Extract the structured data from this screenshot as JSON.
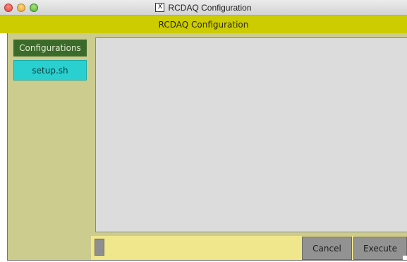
{
  "window": {
    "title": "RCDAQ Configuration",
    "title_icon": "x11-icon"
  },
  "header": {
    "title": "RCDAQ Configuration"
  },
  "sidebar": {
    "heading": "Configurations",
    "items": [
      {
        "label": "setup.sh"
      }
    ]
  },
  "main": {
    "text_content": ""
  },
  "buttons": {
    "cancel": "Cancel",
    "execute": "Execute"
  },
  "colors": {
    "header_bg": "#cdcc00",
    "sidebar_bg": "#cccc8f",
    "heading_bg": "#3b6b2b",
    "item_bg": "#2ad0cf",
    "bottom_bar_bg": "#f0e68c",
    "button_bg": "#929292",
    "text_area_bg": "#dcdcdc"
  }
}
